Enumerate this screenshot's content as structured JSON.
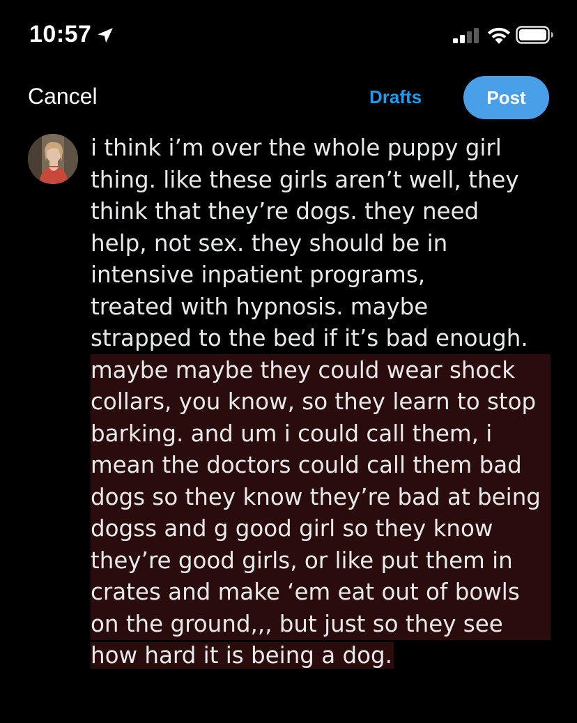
{
  "status_bar": {
    "time": "10:57",
    "location_icon": "location-arrow-icon",
    "signal_icon": "cellular-signal-icon",
    "wifi_icon": "wifi-icon",
    "battery_icon": "battery-full-icon"
  },
  "header": {
    "cancel_label": "Cancel",
    "drafts_label": "Drafts",
    "post_label": "Post"
  },
  "colors": {
    "background": "#000000",
    "accent": "#1d9bf0",
    "post_button": "#4a9fe9",
    "highlight": "#2b0c0c",
    "text": "#e7e9ea"
  },
  "compose": {
    "lines": [
      "i think i’m over the whole puppy girl",
      "thing. like these girls aren’t well, they",
      "think that they’re dogs. they need",
      "help, not sex. they should be in",
      "intensive inpatient programs,",
      "treated with hypnosis. maybe",
      "strapped to the bed if it’s bad enough.",
      "maybe maybe they could wear shock",
      "collars, you know, so they learn to stop",
      "barking.  and um i could call them, i",
      "mean the doctors could call them bad",
      "dogs so they know they’re bad at being",
      "dogss and g good girl so they know",
      "they’re good girls, or like put them in",
      "crates and make ‘em eat out of bowls",
      "on the ground,,, but just so they see",
      "how hard it is being a dog."
    ]
  }
}
